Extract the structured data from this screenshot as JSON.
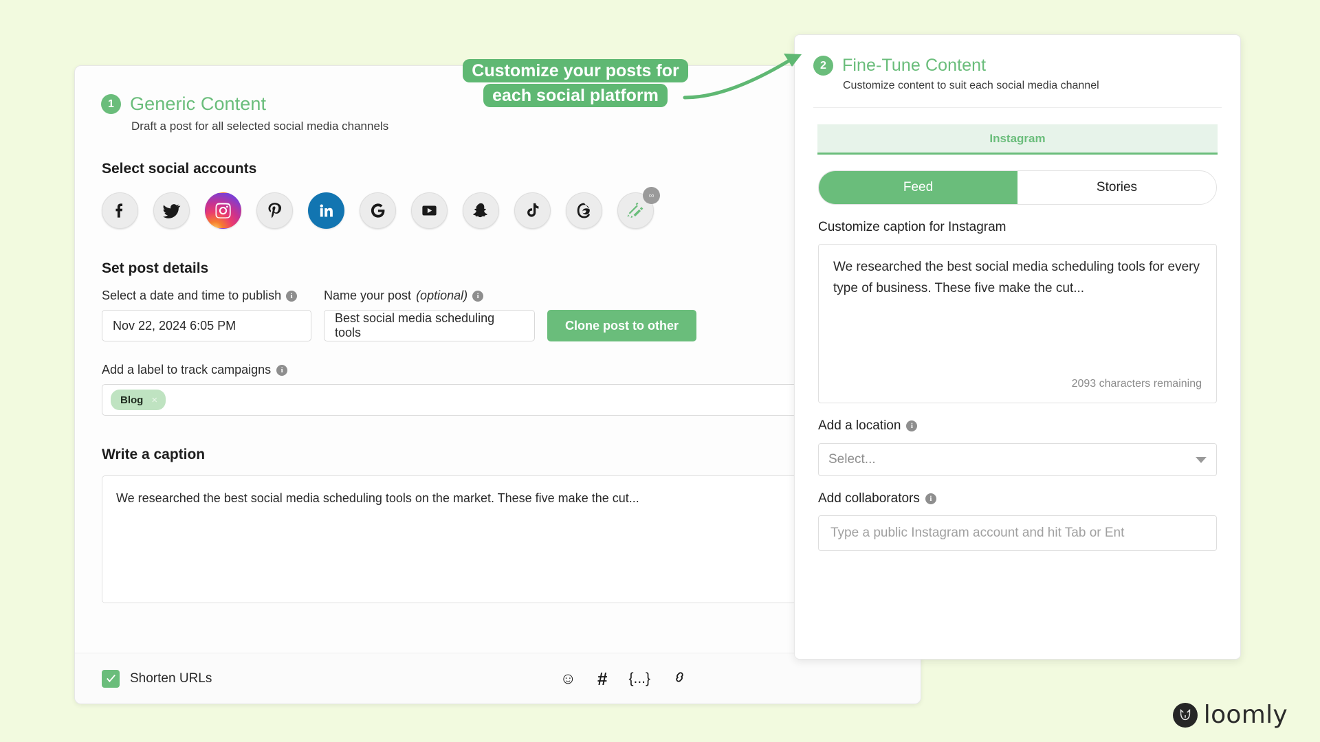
{
  "page": {
    "background_color": "#f2fadf",
    "accent_green": "#6abd7b",
    "brand": "loomly"
  },
  "left_card": {
    "step_number": "1",
    "step_title": "Generic Content",
    "step_subtitle": "Draft a post for all selected social media channels",
    "accounts_section_title": "Select social accounts",
    "accounts": [
      {
        "name": "facebook",
        "label": "Facebook",
        "state": "inactive"
      },
      {
        "name": "twitter",
        "label": "Twitter",
        "state": "inactive"
      },
      {
        "name": "instagram",
        "label": "Instagram",
        "state": "active"
      },
      {
        "name": "pinterest",
        "label": "Pinterest",
        "state": "inactive"
      },
      {
        "name": "linkedin",
        "label": "LinkedIn",
        "state": "active"
      },
      {
        "name": "google-business",
        "label": "Google Business Profile",
        "state": "inactive"
      },
      {
        "name": "youtube",
        "label": "YouTube",
        "state": "inactive"
      },
      {
        "name": "snapchat",
        "label": "Snapchat",
        "state": "inactive"
      },
      {
        "name": "tiktok",
        "label": "TikTok",
        "state": "inactive"
      },
      {
        "name": "threads",
        "label": "Threads",
        "state": "inactive"
      },
      {
        "name": "mock-post",
        "label": "Mock post",
        "state": "inactive",
        "badge": "∞"
      }
    ],
    "details_section_title": "Set post details",
    "date_label": "Select a date and time to publish",
    "date_value": "Nov 22, 2024 6:05 PM",
    "name_label": "Name your post",
    "name_label_optional": "(optional)",
    "name_value": "Best social media scheduling tools",
    "clone_button": "Clone post to other",
    "campaign_label": "Add a label to track campaigns",
    "campaign_chips": [
      {
        "text": "Blog",
        "remove": "×"
      }
    ],
    "caption_section_title": "Write a caption",
    "caption_value": "We researched the best social media scheduling tools on the market. These five make the cut...",
    "footer": {
      "shorten_urls_label": "Shorten URLs",
      "shorten_urls_checked": true,
      "tools": [
        {
          "name": "emoji-icon",
          "glyph": "☺"
        },
        {
          "name": "hashtag-icon",
          "glyph": "#"
        },
        {
          "name": "variable-icon",
          "glyph": "{...}"
        },
        {
          "name": "link-icon",
          "glyph": "⚭"
        }
      ]
    }
  },
  "right_panel": {
    "step_number": "2",
    "step_title": "Fine-Tune Content",
    "step_subtitle": "Customize content to suit each social media channel",
    "channel_tab": "Instagram",
    "post_type_tabs": [
      {
        "label": "Feed",
        "selected": true
      },
      {
        "label": "Stories",
        "selected": false
      }
    ],
    "caption_label": "Customize caption for Instagram",
    "caption_value": "We researched the best social media scheduling tools for every type of business. These five make the cut...",
    "characters_remaining": "2093 characters remaining",
    "location_label": "Add a location",
    "location_placeholder": "Select...",
    "collaborators_label": "Add collaborators",
    "collaborators_placeholder": "Type a public Instagram account and hit Tab or Ent"
  },
  "callout": {
    "text": "Customize your posts for each social platform",
    "background_color": "#5fb873"
  }
}
